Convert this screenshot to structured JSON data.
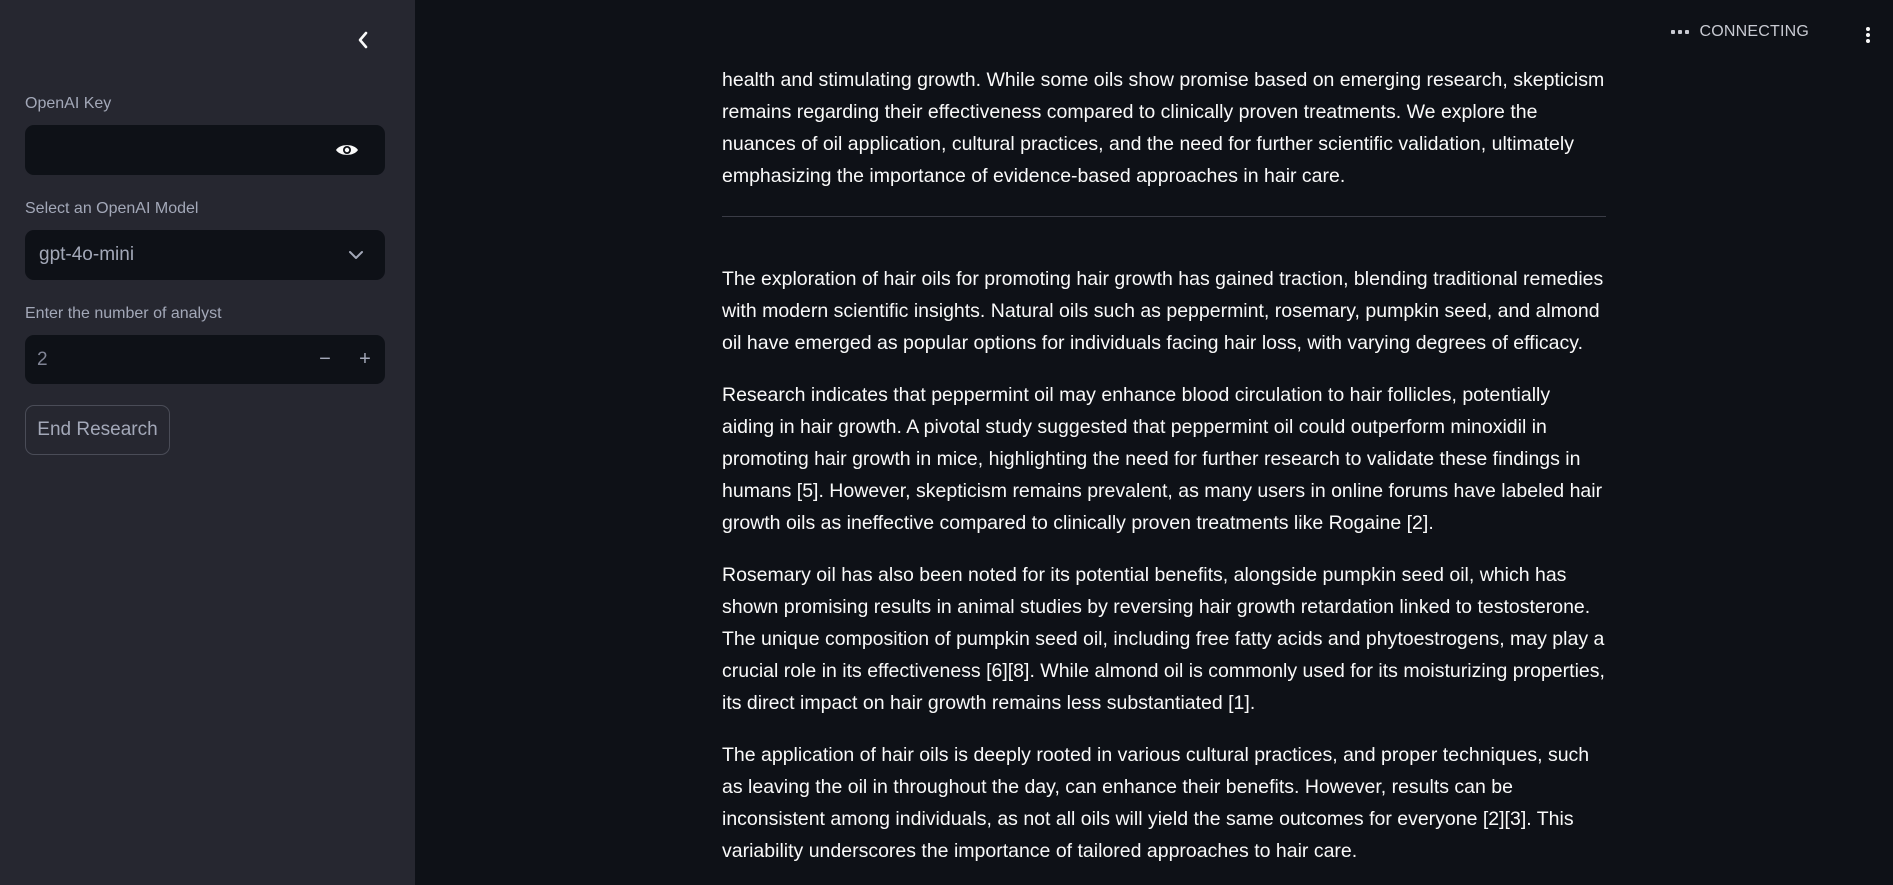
{
  "sidebar": {
    "openai_key": {
      "label": "OpenAI Key",
      "value": "",
      "placeholder": ""
    },
    "model_select": {
      "label": "Select an OpenAI Model",
      "selected": "gpt-4o-mini"
    },
    "analyst_count": {
      "label": "Enter the number of analyst",
      "value": "2",
      "decrement": "−",
      "increment": "+"
    },
    "end_button": "End Research"
  },
  "header": {
    "status": "CONNECTING"
  },
  "report": {
    "intro_paragraph": "health and stimulating growth. While some oils show promise based on emerging research, skepticism remains regarding their effectiveness compared to clinically proven treatments. We explore the nuances of oil application, cultural practices, and the need for further scientific validation, ultimately emphasizing the importance of evidence-based approaches in hair care.",
    "paragraphs": [
      "The exploration of hair oils for promoting hair growth has gained traction, blending traditional remedies with modern scientific insights. Natural oils such as peppermint, rosemary, pumpkin seed, and almond oil have emerged as popular options for individuals facing hair loss, with varying degrees of efficacy.",
      "Research indicates that peppermint oil may enhance blood circulation to hair follicles, potentially aiding in hair growth. A pivotal study suggested that peppermint oil could outperform minoxidil in promoting hair growth in mice, highlighting the need for further research to validate these findings in humans [5]. However, skepticism remains prevalent, as many users in online forums have labeled hair growth oils as ineffective compared to clinically proven treatments like Rogaine [2].",
      "Rosemary oil has also been noted for its potential benefits, alongside pumpkin seed oil, which has shown promising results in animal studies by reversing hair growth retardation linked to testosterone. The unique composition of pumpkin seed oil, including free fatty acids and phytoestrogens, may play a crucial role in its effectiveness [6][8]. While almond oil is commonly used for its moisturizing properties, its direct impact on hair growth remains less substantiated [1].",
      "The application of hair oils is deeply rooted in various cultural practices, and proper techniques, such as leaving the oil in throughout the day, can enhance their benefits. However, results can be inconsistent among individuals, as not all oils will yield the same outcomes for everyone [2][3]. This variability underscores the importance of tailored approaches to hair care."
    ]
  },
  "icons": {
    "collapse": "chevron-left-icon",
    "password_toggle": "eye-icon",
    "select_arrow": "chevron-down-icon",
    "status": "ellipsis-icon",
    "menu": "kebab-menu-icon"
  },
  "colors": {
    "sidebar_bg": "#262730",
    "main_bg": "#0e1117",
    "input_bg": "#0e1117",
    "text": "#fafafa",
    "muted_text": "#a3a8b8"
  }
}
